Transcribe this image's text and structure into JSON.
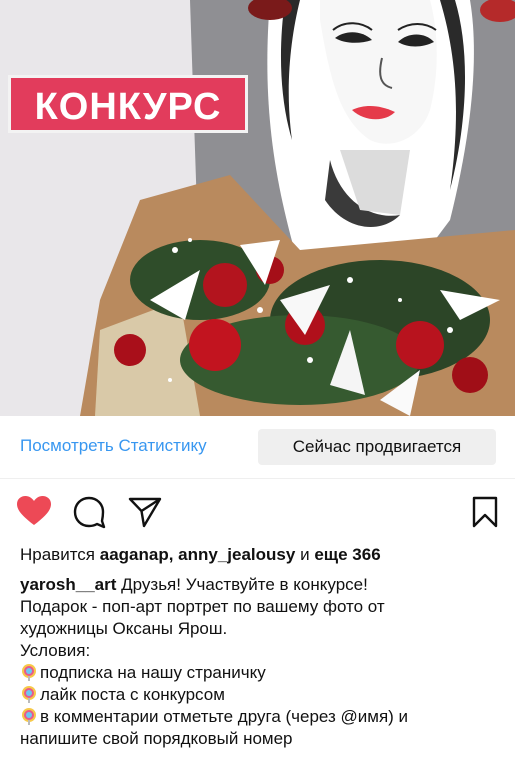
{
  "post": {
    "badge_text": "КОНКУРС"
  },
  "actions": {
    "view_stats_label": "Посмотреть Статистику",
    "promoted_label": "Сейчас продвигается"
  },
  "icons": {
    "like": "heart-filled-icon",
    "comment": "comment-icon",
    "share": "share-icon",
    "save": "bookmark-icon",
    "bullet": "lollipop-icon"
  },
  "colors": {
    "accent_blue": "#3897f0",
    "like_red": "#ed4956",
    "badge_pink": "#e23c5c",
    "button_bg": "#efefef"
  },
  "likes": {
    "prefix": "Нравится",
    "users": "aaganap, anny_jealousy",
    "middle": "и",
    "count": "еще 366"
  },
  "caption": {
    "username": "yarosh__art",
    "line1_text": "Друзья! Участвуйте в конкурсе!",
    "line2": "Подарок - поп-арт портрет по вашему фото от",
    "line3": "художницы Оксаны Ярош.",
    "line4": "Условия:",
    "items": [
      "подписка на нашу страничку",
      "лайк поста с конкурсом",
      "в комментарии отметьте друга (через @имя) и"
    ],
    "line8": "напишите свой порядковый номер"
  }
}
